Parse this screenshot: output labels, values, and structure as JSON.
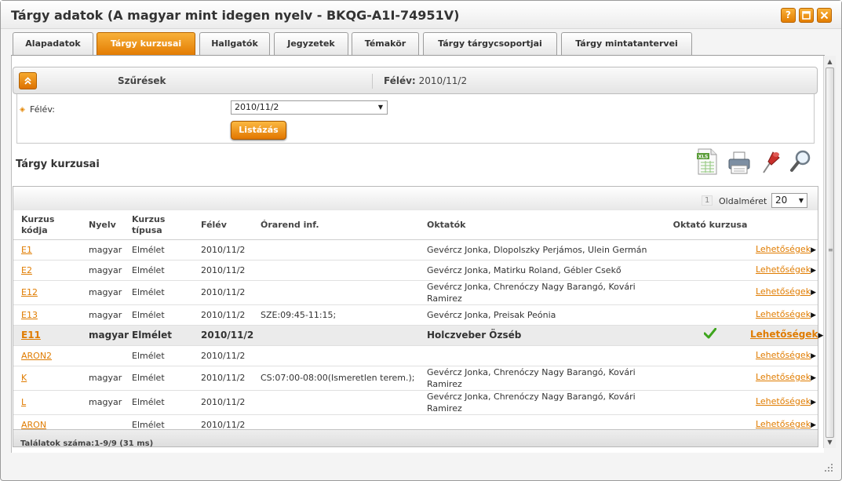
{
  "window": {
    "title": "Tárgy adatok (A magyar mint idegen nyelv - BKQG-A1I-74951V)",
    "help_label": "?"
  },
  "tabs": [
    {
      "label": "Alapadatok",
      "active": false
    },
    {
      "label": "Tárgy kurzusai",
      "active": true
    },
    {
      "label": "Hallgatók",
      "active": false
    },
    {
      "label": "Jegyzetek",
      "active": false
    },
    {
      "label": "Témakör",
      "active": false
    },
    {
      "label": "Tárgy tárgycsoportjai",
      "active": false
    },
    {
      "label": "Tárgy mintatantervei",
      "active": false
    }
  ],
  "filter": {
    "title": "Szűrések",
    "summary_label": "Félév:",
    "summary_value": "2010/11/2",
    "felev_label": "Félév:",
    "felev_selected": "2010/11/2",
    "list_button": "Listázás"
  },
  "section_title": "Tárgy kurzusai",
  "toolbar_icons": [
    "excel-export-icon",
    "print-icon",
    "pin-icon",
    "search-icon"
  ],
  "grid": {
    "page_number": "1",
    "pagesize_label": "Oldalméret",
    "pagesize_value": "20",
    "columns": {
      "code": "Kurzus kódja",
      "lang": "Nyelv",
      "type": "Kurzus típusa",
      "felev": "Félév",
      "orarend": "Órarend inf.",
      "oktatok": "Oktatók",
      "ok": "Oktató kurzusa"
    },
    "rows": [
      {
        "code": "E1",
        "lang": "magyar",
        "type": "Elmélet",
        "felev": "2010/11/2",
        "orarend": "",
        "oktatok": "Gevércz Jonka, Dlopolszky Perjámos, Ulein Germán",
        "ok": false,
        "action": "Lehetőségek",
        "highlight": false,
        "tall": false
      },
      {
        "code": "E2",
        "lang": "magyar",
        "type": "Elmélet",
        "felev": "2010/11/2",
        "orarend": "",
        "oktatok": "Gevércz Jonka, Matirku Roland, Gébler Csekő",
        "ok": false,
        "action": "Lehetőségek",
        "highlight": false,
        "tall": false
      },
      {
        "code": "E12",
        "lang": "magyar",
        "type": "Elmélet",
        "felev": "2010/11/2",
        "orarend": "",
        "oktatok": "Gevércz Jonka, Chrenóczy Nagy Barangó, Kovári Ramirez",
        "ok": false,
        "action": "Lehetőségek",
        "highlight": false,
        "tall": true
      },
      {
        "code": "E13",
        "lang": "magyar",
        "type": "Elmélet",
        "felev": "2010/11/2",
        "orarend": "SZE:09:45-11:15;",
        "oktatok": "Gevércz Jonka, Preisak Peónia",
        "ok": false,
        "action": "Lehetőségek",
        "highlight": false,
        "tall": false
      },
      {
        "code": "E11",
        "lang": "magyar",
        "type": "Elmélet",
        "felev": "2010/11/2",
        "orarend": "",
        "oktatok": "Holczveber Özséb",
        "ok": true,
        "action": "Lehetőségek",
        "highlight": true,
        "tall": false
      },
      {
        "code": "ARON2",
        "lang": "",
        "type": "Elmélet",
        "felev": "2010/11/2",
        "orarend": "",
        "oktatok": "",
        "ok": false,
        "action": "Lehetőségek",
        "highlight": false,
        "tall": false
      },
      {
        "code": "K",
        "lang": "magyar",
        "type": "Elmélet",
        "felev": "2010/11/2",
        "orarend": "CS:07:00-08:00(Ismeretlen terem.);",
        "oktatok": "Gevércz Jonka, Chrenóczy Nagy Barangó, Kovári Ramirez",
        "ok": false,
        "action": "Lehetőségek",
        "highlight": false,
        "tall": true
      },
      {
        "code": "L",
        "lang": "magyar",
        "type": "Elmélet",
        "felev": "2010/11/2",
        "orarend": "",
        "oktatok": "Gevércz Jonka, Chrenóczy Nagy Barangó, Kovári Ramirez",
        "ok": false,
        "action": "Lehetőségek",
        "highlight": false,
        "tall": true
      },
      {
        "code": "ARON",
        "lang": "",
        "type": "Elmélet",
        "felev": "2010/11/2",
        "orarend": "",
        "oktatok": "",
        "ok": false,
        "action": "Lehetőségek",
        "highlight": false,
        "tall": false
      }
    ],
    "footer": "Találatok száma:1-9/9 (31 ms)"
  },
  "colors": {
    "accent": "#e88a00",
    "link": "#e07c00",
    "check": "#3ea51d"
  }
}
